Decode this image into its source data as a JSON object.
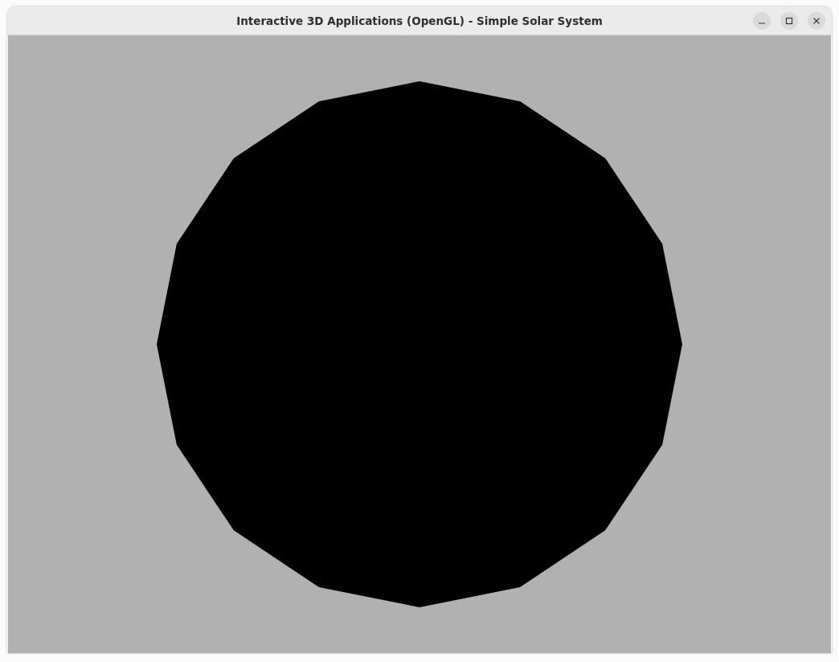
{
  "window": {
    "title": "Interactive 3D Applications (OpenGL) - Simple Solar System"
  }
}
